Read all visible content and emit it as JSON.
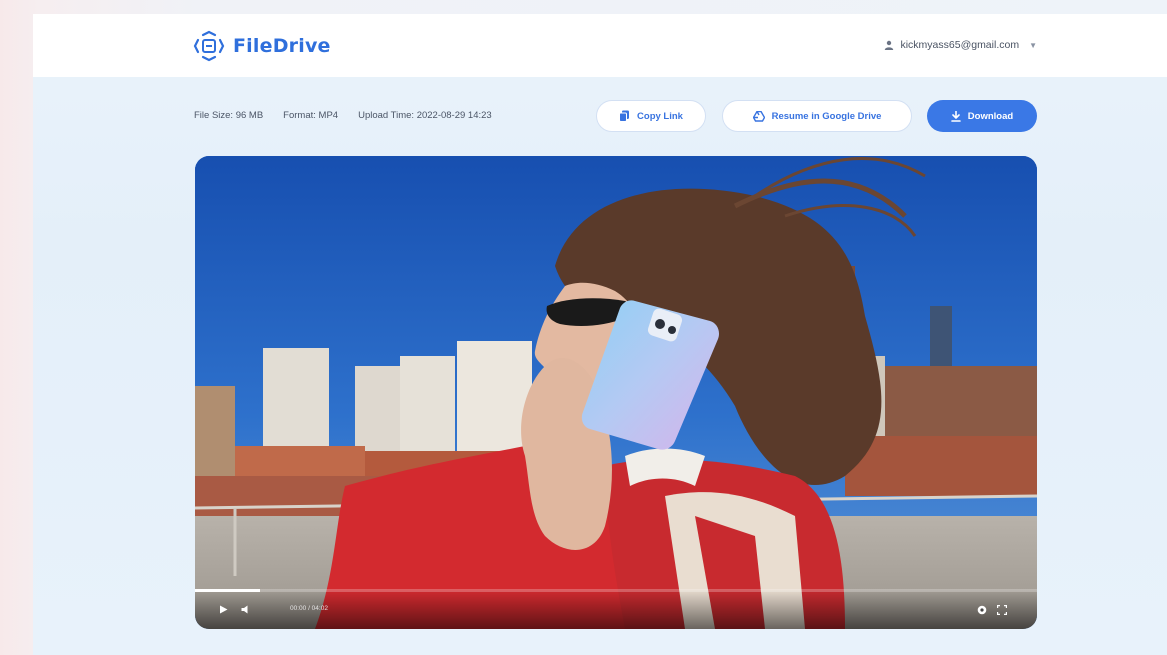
{
  "app": {
    "name": "FileDrive"
  },
  "account": {
    "email": "kickmyass65@gmail.com"
  },
  "file_info": {
    "size": "File Size: 96 MB",
    "format": "Format: MP4",
    "upload_time": "Upload Time: 2022-08-29 14:23"
  },
  "actions": {
    "copy_link": "Copy Link",
    "resume": "Resume in Google Drive",
    "download": "Download"
  },
  "player": {
    "time": "00:00 / 04:02",
    "progress": 0.077
  },
  "colors": {
    "brand": "#2f6fdc",
    "primary_button": "#3a78e6"
  },
  "icons": [
    "logo-icon",
    "user-icon",
    "chevron-down-icon",
    "copy-icon",
    "drive-icon",
    "download-icon",
    "play-icon",
    "volume-icon",
    "settings-icon",
    "fullscreen-icon"
  ]
}
